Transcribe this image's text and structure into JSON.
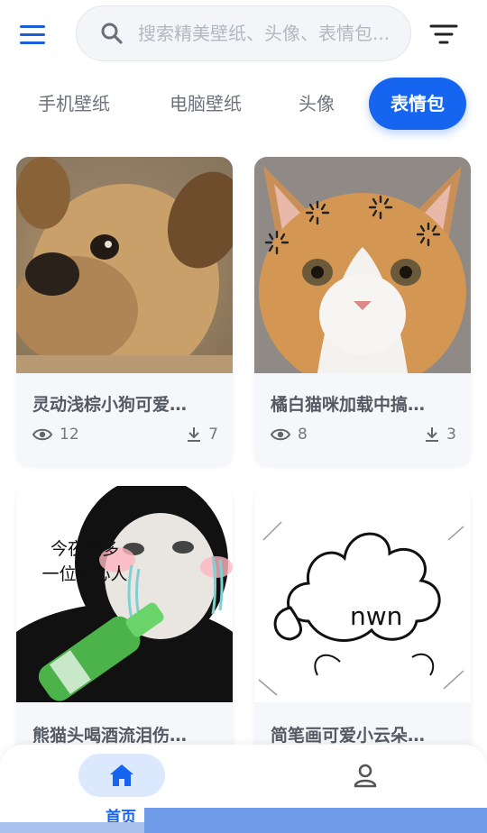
{
  "search": {
    "placeholder": "搜索精美壁纸、头像、表情包..."
  },
  "tabs": [
    {
      "label": "手机壁纸",
      "active": false
    },
    {
      "label": "电脑壁纸",
      "active": false
    },
    {
      "label": "头像",
      "active": false
    },
    {
      "label": "表情包",
      "active": true
    }
  ],
  "cards": [
    {
      "title": "灵动浅棕小狗可爱…",
      "views": "12",
      "downloads": "7"
    },
    {
      "title": "橘白猫咪加载中搞…",
      "views": "8",
      "downloads": "3"
    },
    {
      "title": "熊猫头喝酒流泪伤…",
      "caption_line1": "今夜又多",
      "caption_line2": "一位伤心人"
    },
    {
      "title": "简笔画可爱小云朵…",
      "doodle_text": "nwn"
    }
  ],
  "bottom_nav": {
    "home_label": "首页"
  },
  "colors": {
    "accent": "#1565f0",
    "menu": "#1a5fd9"
  }
}
